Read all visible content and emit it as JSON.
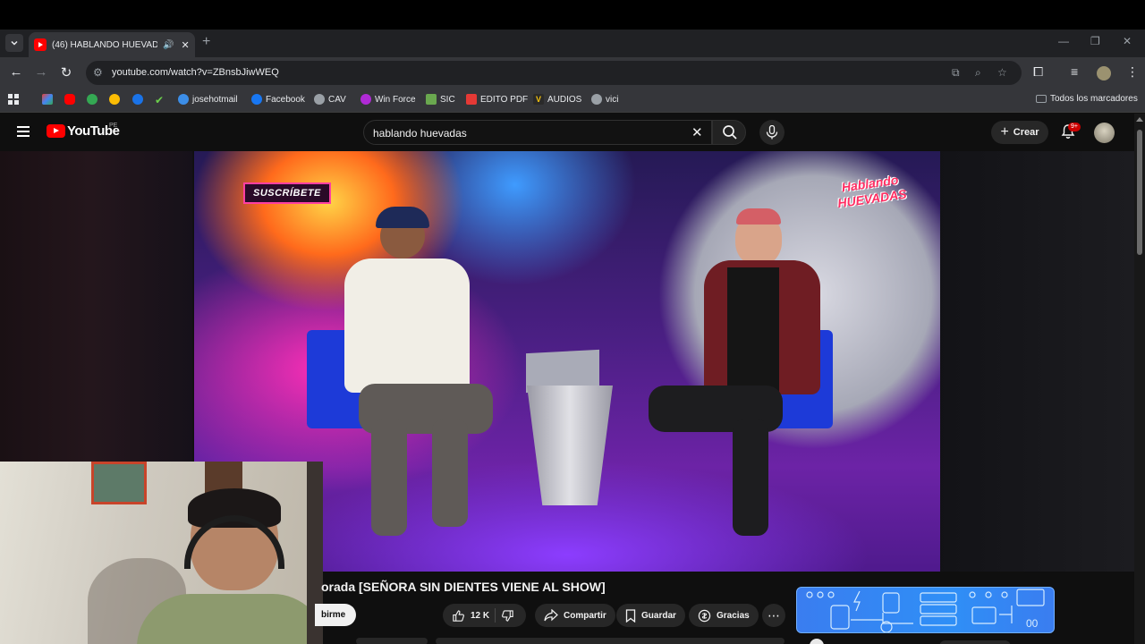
{
  "browser": {
    "tab": {
      "title": "(46) HABLANDO HUEVADA",
      "audio_icon": "speaker-icon",
      "close_icon": "close-icon"
    },
    "url": "youtube.com/watch?v=ZBnsbJiwWEQ",
    "bookmarks": [
      {
        "label": "josehotmail",
        "icon": "globe-icon"
      },
      {
        "label": "Facebook",
        "icon": "facebook-icon"
      },
      {
        "label": "CAV",
        "icon": "globe-icon"
      },
      {
        "label": "Win Force",
        "icon": "winforce-icon"
      },
      {
        "label": "SIC",
        "icon": "sic-icon"
      },
      {
        "label": "EDITO PDF",
        "icon": "pdf-icon"
      },
      {
        "label": "AUDIOS",
        "icon": "v-icon"
      },
      {
        "label": "vici",
        "icon": "globe-icon"
      }
    ],
    "all_bookmarks": "Todos los marcadores"
  },
  "youtube": {
    "logo_text": "YouTube",
    "country": "PE",
    "search_query": "hablando huevadas",
    "create_label": "Crear",
    "notification_badge": "9+"
  },
  "video": {
    "overlay_subscribe": "SUSCRÍBETE",
    "show_logo_line1": "Hablando",
    "show_logo_line2": "HUEVADAS",
    "title": "orada [SEÑORA SIN DIENTES VIENE AL SHOW]",
    "subscribe_label": "birme",
    "like_count": "12 K",
    "share_label": "Compartir",
    "save_label": "Guardar",
    "thanks_label": "Gracias",
    "more_label": "⋯"
  },
  "colors": {
    "youtube_red": "#ff0000",
    "page_bg": "#0f0f0f",
    "chrome_toolbar": "#35363a",
    "ad_blue": "#2f8ff6"
  }
}
